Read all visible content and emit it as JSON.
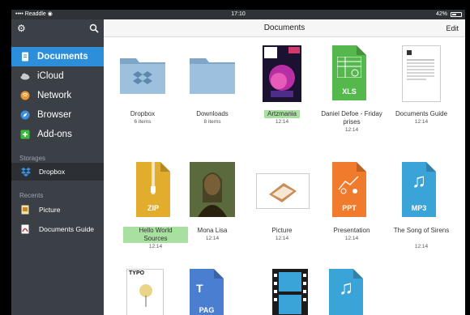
{
  "status": {
    "carrier": "Readdle",
    "time": "17:10",
    "battery": "42%"
  },
  "sidebar": {
    "items": [
      {
        "label": "Documents",
        "icon": "document-icon",
        "color": "#ffffff"
      },
      {
        "label": "iCloud",
        "icon": "cloud-icon",
        "color": "#c7cbd0"
      },
      {
        "label": "Network",
        "icon": "network-icon",
        "color": "#f0962e"
      },
      {
        "label": "Browser",
        "icon": "compass-icon",
        "color": "#3a8fe0"
      },
      {
        "label": "Add-ons",
        "icon": "plus-icon",
        "color": "#3cbb3c"
      }
    ],
    "storages_header": "Storages",
    "storages": [
      {
        "label": "Dropbox"
      }
    ],
    "recents_header": "Recents",
    "recents": [
      {
        "label": "Picture"
      },
      {
        "label": "Documents Guide"
      }
    ]
  },
  "main": {
    "title": "Documents",
    "edit": "Edit",
    "items": [
      {
        "name": "Dropbox",
        "sub": "6 items"
      },
      {
        "name": "Downloads",
        "sub": "8 items"
      },
      {
        "name": "Artzmania",
        "sub": "12:14"
      },
      {
        "name": "Daniel Defoe - Friday prises",
        "sub": "12:14",
        "label": "XLS"
      },
      {
        "name": "Documents Guide",
        "sub": "12:14"
      },
      {
        "name": "Hello World Sources",
        "sub": "12:14",
        "label": "ZIP"
      },
      {
        "name": "Mona Lisa",
        "sub": "12:14"
      },
      {
        "name": "Picture",
        "sub": "12:14"
      },
      {
        "name": "Presentation",
        "sub": "12:14",
        "label": "PPT"
      },
      {
        "name": "The Song of Sirens",
        "sub": "12:14",
        "label": "MP3"
      },
      {
        "name": "",
        "sub": "",
        "label": "TYPO"
      },
      {
        "name": "",
        "sub": "",
        "label": "PAG"
      },
      {
        "name": "",
        "sub": ""
      },
      {
        "name": "",
        "sub": ""
      }
    ]
  }
}
